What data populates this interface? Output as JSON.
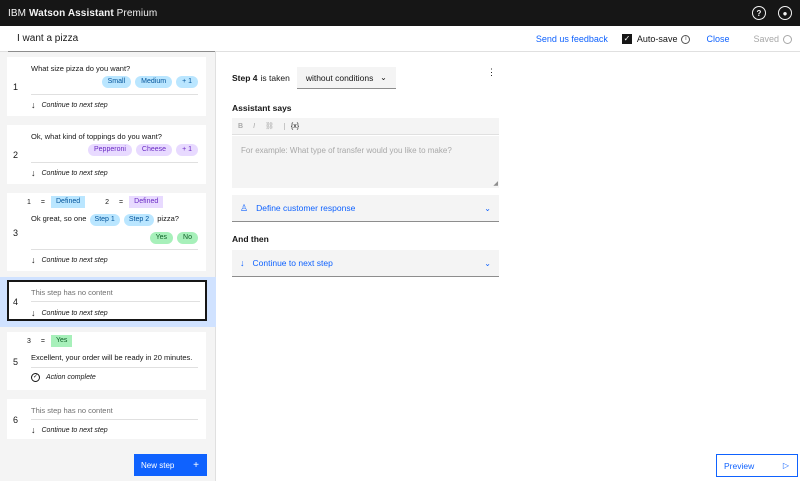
{
  "topbar": {
    "brand_prefix": "IBM",
    "brand_bold": "Watson Assistant",
    "brand_suffix": "Premium",
    "help_icon": "help-icon",
    "user_icon": "user-avatar-icon"
  },
  "header": {
    "action_name": "I want a pizza",
    "feedback_link": "Send us feedback",
    "autosave_label": "Auto-save",
    "close_label": "Close",
    "saved_label": "Saved"
  },
  "steps": [
    {
      "number": "1",
      "text": "What size pizza do you want?",
      "tags": [
        "Small",
        "Medium",
        "+ 1"
      ],
      "next": "Continue to next step"
    },
    {
      "number": "2",
      "text": "Ok, what kind of toppings do you want?",
      "tags": [
        "Pepperoni",
        "Cheese",
        "+ 1"
      ],
      "next": "Continue to next step"
    },
    {
      "number": "3",
      "conditions": [
        {
          "step": "1",
          "op": "=",
          "value": "Defined"
        },
        {
          "step": "2",
          "op": "=",
          "value": "Defined"
        }
      ],
      "text_before": "Ok great, so one",
      "var1": "Step 1",
      "var2": "Step 2",
      "text_after": "pizza?",
      "tags": [
        "Yes",
        "No"
      ],
      "next": "Continue to next step"
    },
    {
      "number": "4",
      "empty_text": "This step has no content",
      "next": "Continue to next step"
    },
    {
      "number": "5",
      "conditions": [
        {
          "step": "3",
          "op": "=",
          "value": "Yes"
        }
      ],
      "text": "Excellent, your order will be ready in 20 minutes.",
      "next": "Action complete"
    },
    {
      "number": "6",
      "empty_text": "This step has no content",
      "next": "Continue to next step"
    }
  ],
  "new_step_label": "New step",
  "editor": {
    "step_label": "Step 4",
    "taken_label": "is taken",
    "condition_value": "without conditions",
    "assistant_says": "Assistant says",
    "toolbar": [
      "B",
      "I",
      "⛓",
      "{x}"
    ],
    "placeholder": "For example: What type of transfer would you like to make?",
    "define_response": "Define customer response",
    "and_then": "And then",
    "continue_label": "Continue to next step",
    "preview_label": "Preview"
  },
  "colors": {
    "accent": "#0f62fe",
    "topbar": "#161616",
    "tag_blue": "#bae6ff",
    "tag_purple": "#e8daff",
    "tag_green": "#a7f0ba"
  }
}
